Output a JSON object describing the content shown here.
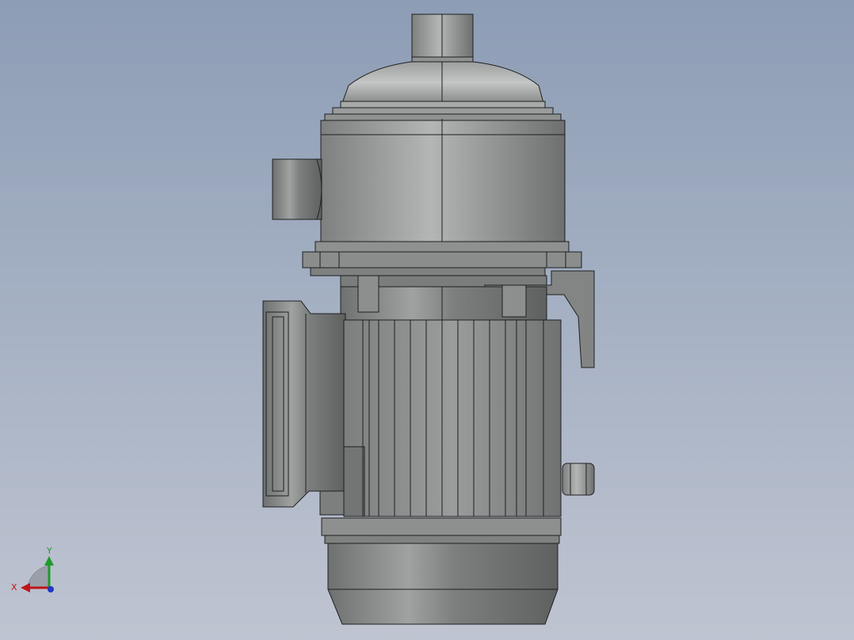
{
  "viewport": {
    "background_top": "#8d9db5",
    "background_bottom": "#bfc4d1"
  },
  "model": {
    "body_color": "#8b8d8c",
    "body_light": "#b4b6b5",
    "body_dark": "#5f6261",
    "edge_color": "#1f1f1f"
  },
  "triad": {
    "x_label": "X",
    "y_label": "Y",
    "x_color": "#c0141b",
    "y_color": "#1f9a2c",
    "z_color": "#1d39c4"
  }
}
